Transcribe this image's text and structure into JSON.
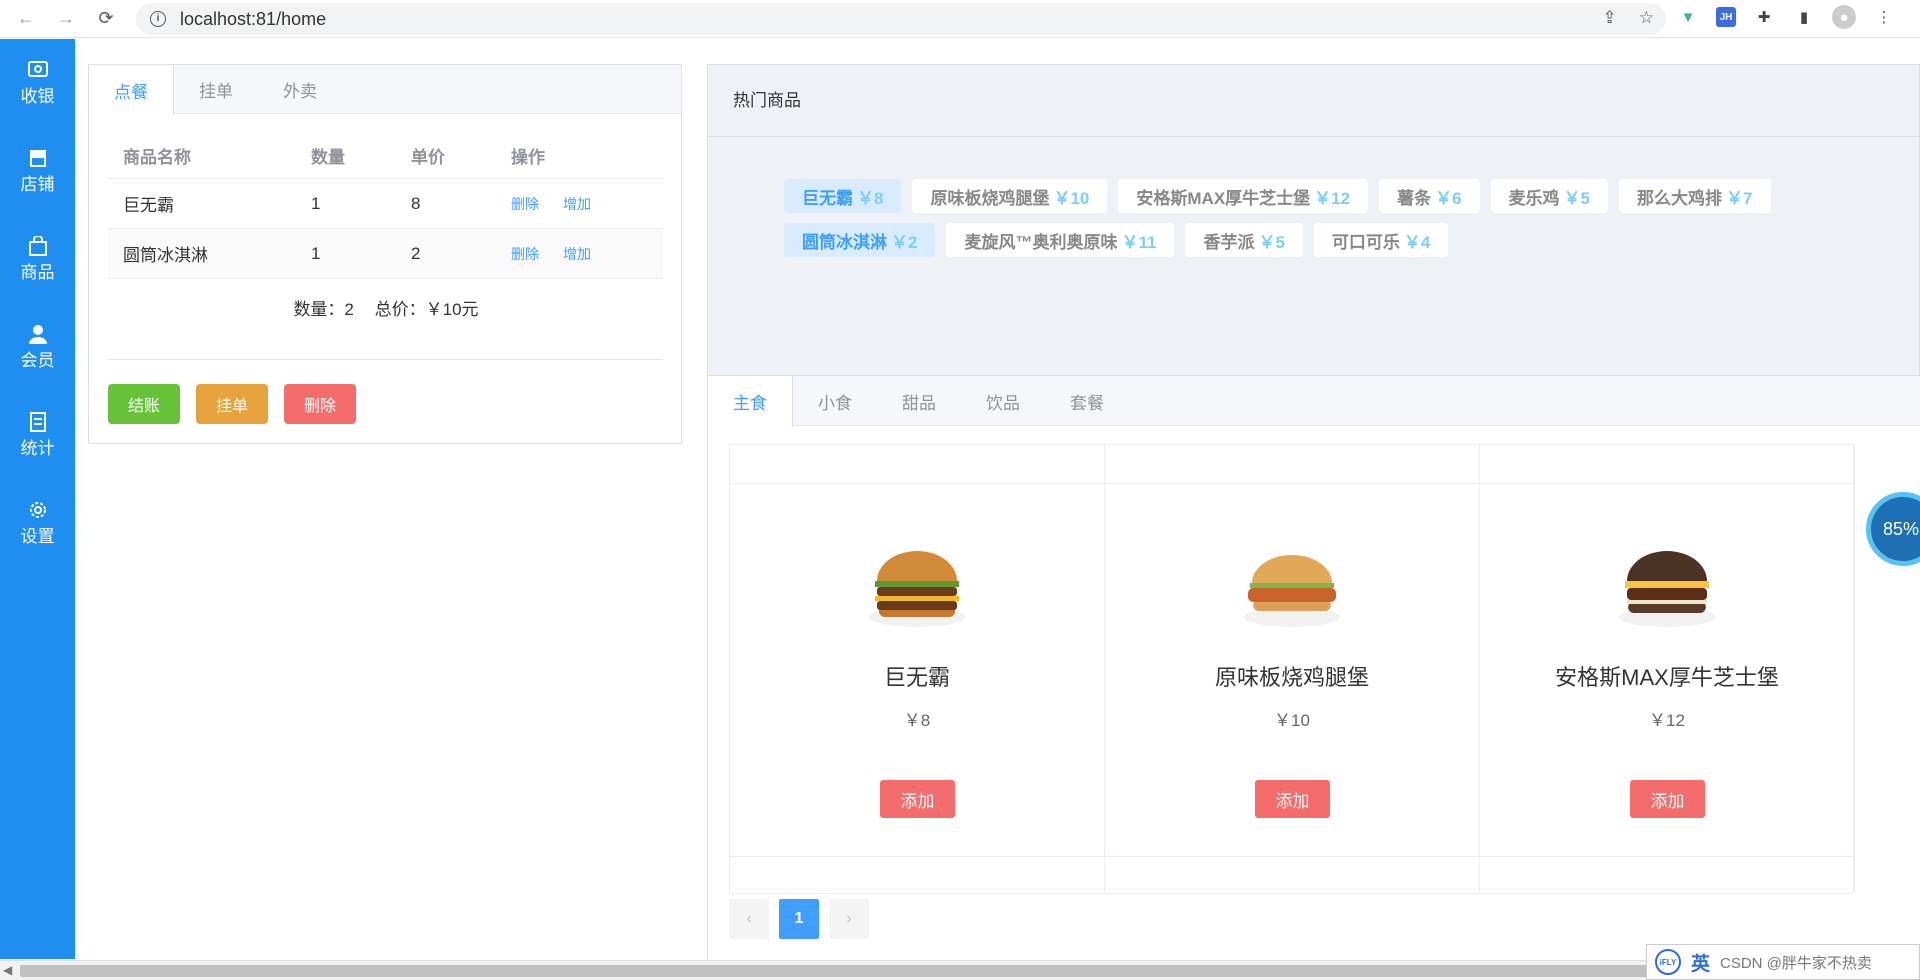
{
  "browser": {
    "url": "localhost:81/home"
  },
  "sidebar": {
    "items": [
      {
        "label": "收银",
        "icon": "cashier-icon"
      },
      {
        "label": "店铺",
        "icon": "shop-icon"
      },
      {
        "label": "商品",
        "icon": "bag-icon"
      },
      {
        "label": "会员",
        "icon": "user-icon"
      },
      {
        "label": "统计",
        "icon": "document-icon"
      },
      {
        "label": "设置",
        "icon": "gear-icon"
      }
    ]
  },
  "order": {
    "tabs": [
      "点餐",
      "挂单",
      "外卖"
    ],
    "columns": [
      "商品名称",
      "数量",
      "单价",
      "操作"
    ],
    "rows": [
      {
        "name": "巨无霸",
        "qty": "1",
        "price": "8",
        "del": "删除",
        "add": "增加"
      },
      {
        "name": "圆筒冰淇淋",
        "qty": "1",
        "price": "2",
        "del": "删除",
        "add": "增加"
      }
    ],
    "summary_count": "数量：2",
    "summary_total": "总价：￥10元",
    "buttons": {
      "checkout": "结账",
      "hold": "挂单",
      "delete": "删除"
    }
  },
  "hot": {
    "title": "热门商品",
    "items": [
      {
        "name": "巨无霸",
        "price": "￥8"
      },
      {
        "name": "原味板烧鸡腿堡",
        "price": "￥10"
      },
      {
        "name": "安格斯MAX厚牛芝士堡",
        "price": "￥12"
      },
      {
        "name": "薯条",
        "price": "￥6"
      },
      {
        "name": "麦乐鸡",
        "price": "￥5"
      },
      {
        "name": "那么大鸡排",
        "price": "￥7"
      },
      {
        "name": "圆筒冰淇淋",
        "price": "￥2"
      },
      {
        "name": "麦旋风™奥利奥原味",
        "price": "￥11"
      },
      {
        "name": "香芋派",
        "price": "￥5"
      },
      {
        "name": "可口可乐",
        "price": "￥4"
      }
    ]
  },
  "categories": {
    "tabs": [
      "主食",
      "小食",
      "甜品",
      "饮品",
      "套餐"
    ]
  },
  "goods": [
    {
      "name": "巨无霸",
      "price": "￥8",
      "add": "添加"
    },
    {
      "name": "原味板烧鸡腿堡",
      "price": "￥10",
      "add": "添加"
    },
    {
      "name": "安格斯MAX厚牛芝士堡",
      "price": "￥12",
      "add": "添加"
    }
  ],
  "pager": {
    "prev": "‹",
    "current": "1",
    "next": "›"
  },
  "widgets": {
    "speed": "85%",
    "ime_lang": "英",
    "ime_logo": "iFLY",
    "watermark": "CSDN @胖牛家不热卖"
  },
  "colors": {
    "sidebar": "#1f8ef1",
    "accent": "#409eff",
    "success": "#67c23a",
    "warning": "#e6a23c",
    "danger": "#f56c6c"
  }
}
